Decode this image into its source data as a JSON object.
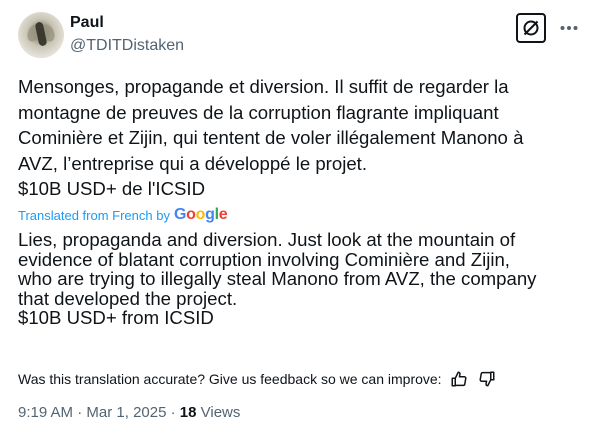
{
  "author": {
    "display_name": "Paul",
    "handle": "@TDITDistaken"
  },
  "tweet": {
    "text": "Mensonges, propagande et diversion. Il suffit de regarder la\nmontagne de preuves de la corruption flagrante impliquant\nCominière et Zijin, qui tentent de voler illégalement Manono à\nAVZ, l’entreprise qui a développé le projet.\n$10B USD+ de l'ICSID",
    "translated_label": "Translated from French by",
    "translator_logo": "Google",
    "translation": "Lies, propaganda and diversion. Just look at the mountain of\nevidence of blatant corruption involving Cominière and Zijin,\nwho are trying to illegally steal Manono from AVZ, the company\nthat developed the project.\n$10B USD+ from ICSID"
  },
  "feedback": {
    "prompt": "Was this translation accurate? Give us feedback so we can improve:",
    "like_icon": "thumbs-up-icon",
    "dislike_icon": "thumbs-down-icon"
  },
  "meta": {
    "time": "9:19 AM",
    "separator": "·",
    "date": "Mar 1, 2025",
    "views_count": "18",
    "views_label": "Views"
  },
  "icons": {
    "grok": "grok-icon",
    "more": "more-icon"
  },
  "colors": {
    "link": "#1d9bf0",
    "secondary_text": "#536471",
    "primary_text": "#0f1419"
  }
}
